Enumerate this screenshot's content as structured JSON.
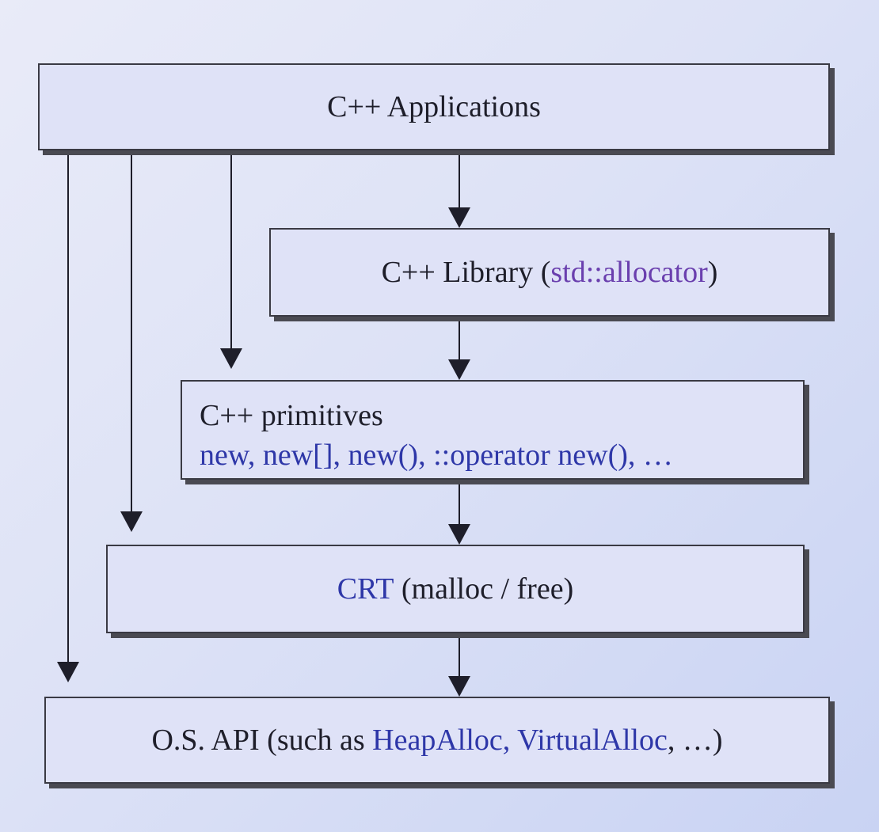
{
  "boxes": {
    "apps": {
      "label": "C++ Applications"
    },
    "library": {
      "prefix": "C++ Library (",
      "highlight": "std::allocator",
      "suffix": ")"
    },
    "primitives": {
      "title": "C++ primitives",
      "items": "new, new[], new(), ::operator new(), …"
    },
    "crt": {
      "highlight": "CRT",
      "rest": " (malloc / free)"
    },
    "os": {
      "prefix": "O.S. API (such as ",
      "highlight": "HeapAlloc, VirtualAlloc",
      "suffix": ", …)"
    }
  },
  "colors": {
    "highlight_blue": "#2e37a8",
    "highlight_purple": "#6a3fae",
    "box_fill": "#dfe2f7",
    "border": "#3a3a44"
  }
}
